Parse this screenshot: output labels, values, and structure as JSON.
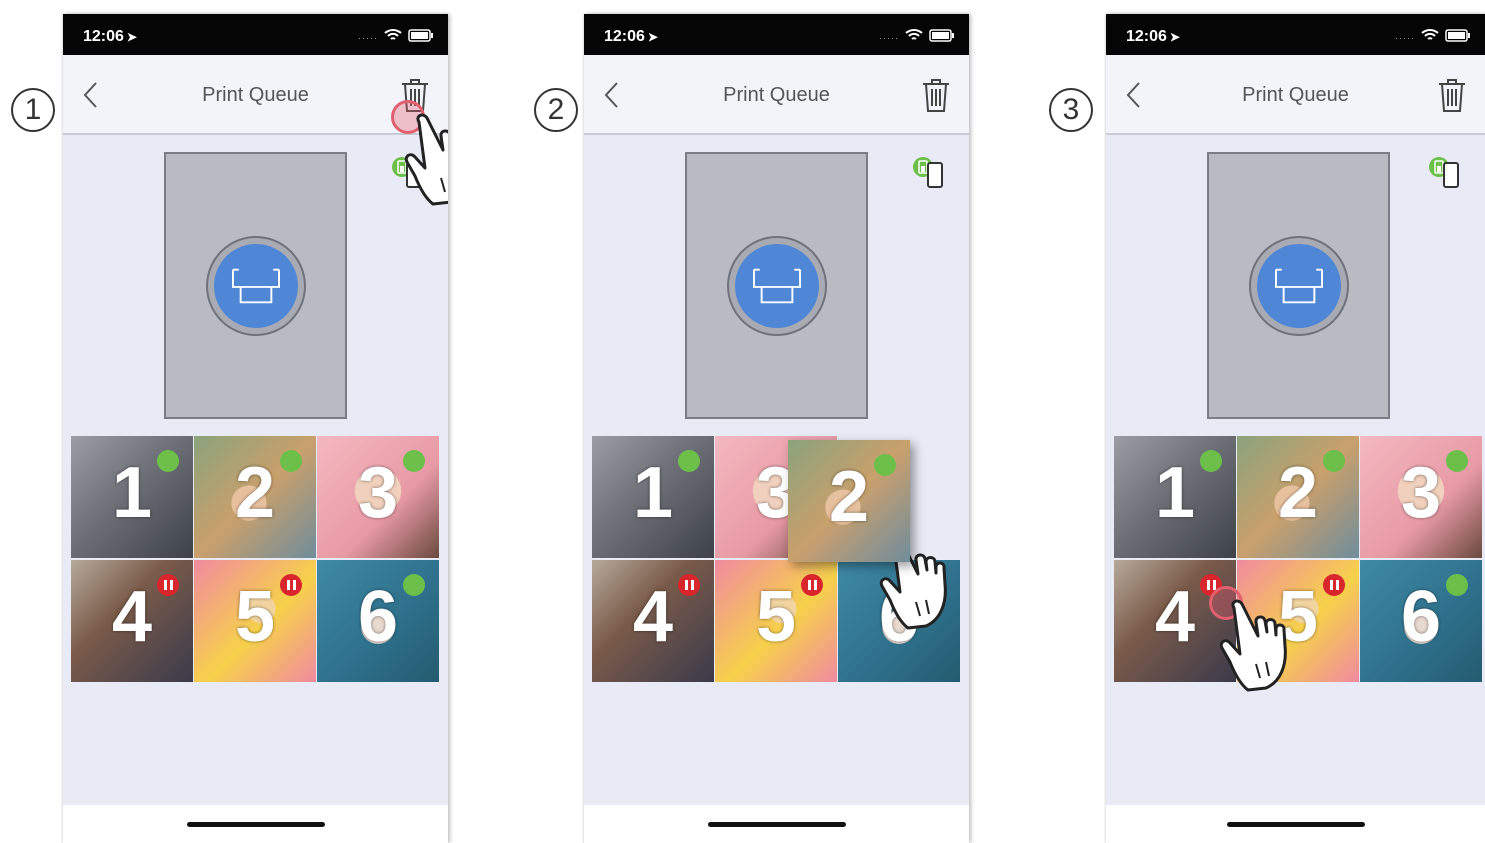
{
  "steps": [
    {
      "badge": "1",
      "status": {
        "time": "12:06"
      },
      "nav": {
        "title": "Print Queue"
      },
      "tiles": [
        {
          "label": "1",
          "status": "ready",
          "bg": "bg-1"
        },
        {
          "label": "2",
          "status": "ready",
          "bg": "bg-2"
        },
        {
          "label": "3",
          "status": "ready",
          "bg": "bg-3"
        },
        {
          "label": "4",
          "status": "paused",
          "bg": "bg-4"
        },
        {
          "label": "5",
          "status": "paused",
          "bg": "bg-5"
        },
        {
          "label": "6",
          "status": "ready",
          "bg": "bg-6"
        }
      ],
      "gesture": "tap-trash-icon"
    },
    {
      "badge": "2",
      "status": {
        "time": "12:06"
      },
      "nav": {
        "title": "Print Queue"
      },
      "tiles": [
        {
          "label": "1",
          "status": "ready",
          "bg": "bg-1"
        },
        {
          "label": "3",
          "status": "ready",
          "bg": "bg-3"
        },
        {
          "label": "2",
          "status": "ready",
          "bg": "bg-2",
          "dragging": true
        },
        {
          "label": "4",
          "status": "paused",
          "bg": "bg-4"
        },
        {
          "label": "5",
          "status": "paused",
          "bg": "bg-5"
        },
        {
          "label": "6",
          "status": "ready",
          "bg": "bg-6"
        }
      ],
      "gesture": "drag-photo"
    },
    {
      "badge": "3",
      "status": {
        "time": "12:06"
      },
      "nav": {
        "title": "Print Queue"
      },
      "tiles": [
        {
          "label": "1",
          "status": "ready",
          "bg": "bg-1"
        },
        {
          "label": "2",
          "status": "ready",
          "bg": "bg-2"
        },
        {
          "label": "3",
          "status": "ready",
          "bg": "bg-3"
        },
        {
          "label": "4",
          "status": "paused",
          "bg": "bg-4"
        },
        {
          "label": "5",
          "status": "paused",
          "bg": "bg-5"
        },
        {
          "label": "6",
          "status": "ready",
          "bg": "bg-6"
        }
      ],
      "gesture": "tap-pause-icon"
    }
  ],
  "colors": {
    "accent": "#4f87d6",
    "ready": "#6cc04a",
    "paused": "#d9262c",
    "tap_ring": "#e06070"
  }
}
